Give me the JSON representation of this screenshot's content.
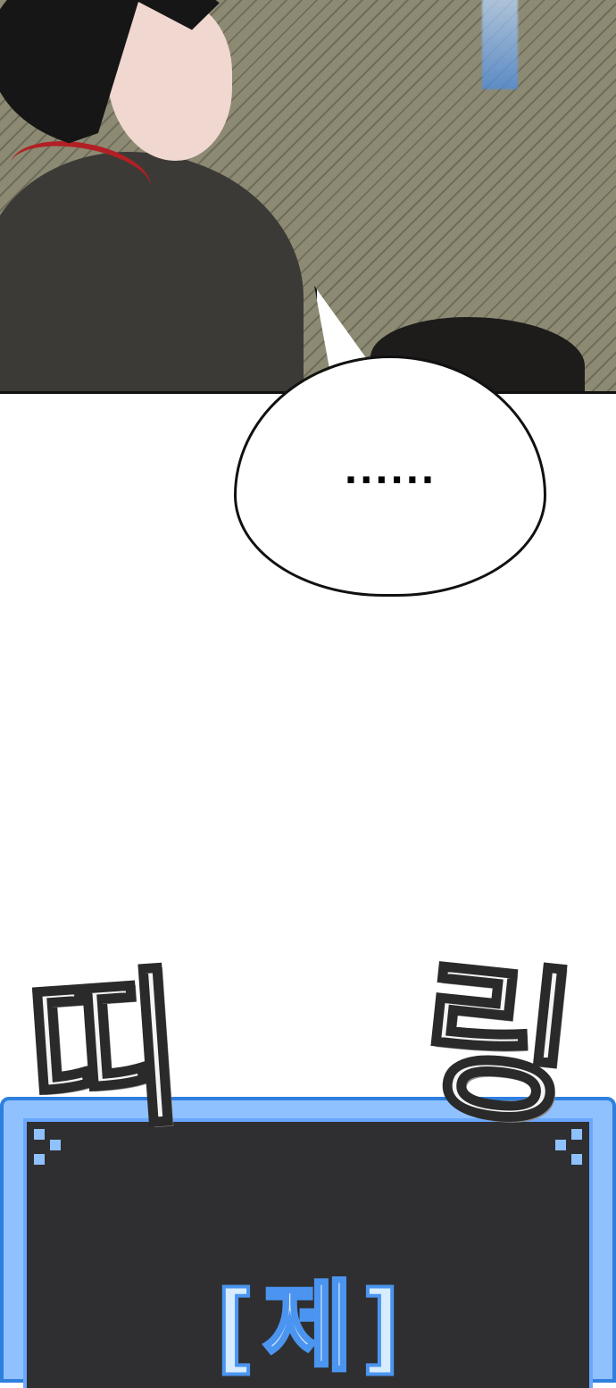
{
  "speech_bubble": {
    "text": "......"
  },
  "sound_effect": {
    "syllable_1": "띠",
    "syllable_2": "링"
  },
  "system_window": {
    "title": "[제]"
  },
  "colors": {
    "window_border": "#2f7fe0",
    "window_fill": "#2f2f31",
    "window_light": "#8fc1ff"
  }
}
